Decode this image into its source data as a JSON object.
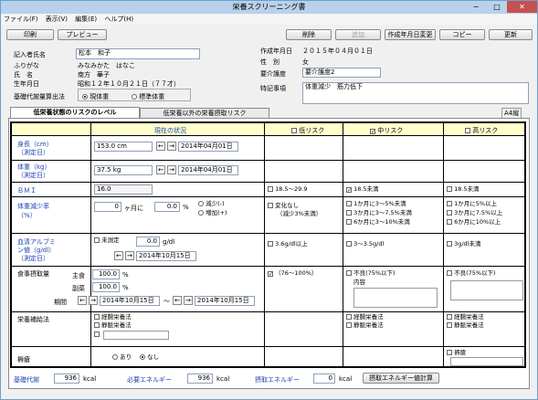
{
  "window": {
    "title": "栄養スクリーニング書",
    "min": "─",
    "max": "□",
    "close": "✕"
  },
  "menu": [
    "ファイル(F)",
    "表示(V)",
    "編集(E)",
    "ヘルプ(H)"
  ],
  "toolbar": {
    "print": "印刷",
    "preview": "プレビュー",
    "delete": "削除",
    "add": "追加",
    "create_date_change": "作成年月日変更",
    "copy": "コピー",
    "update": "更新"
  },
  "patient": {
    "writer_label": "記入者氏名",
    "writer": "松本　和子",
    "furigana_label": "ふりがな",
    "furigana": "みなみかた　はなこ",
    "name_label": "氏　名",
    "name": "南方　華子",
    "dob_label": "生年月日",
    "dob": "昭和１２年１０月２１日（７７才）",
    "bmr_method_label": "基礎代謝量算出法",
    "bmr_opt1": "現体重",
    "bmr_opt2": "標準体重",
    "created_label": "作成年月日",
    "created": "２０１５年０４月０１日",
    "sex_label": "性　別",
    "sex": "女",
    "care_label": "要介護度",
    "care": "要介護度2",
    "notes_label": "特記事項",
    "notes": "体重減少　筋力低下",
    "paper": "A4縦"
  },
  "tabs": [
    "低栄養状態のリスクのレベル",
    "低栄養以外の栄養摂取リスク"
  ],
  "header": {
    "current": "現在の状況",
    "low": "低リスク",
    "mid": "中リスク",
    "high": "高リスク"
  },
  "rows": {
    "height": {
      "label1": "身長（cm）",
      "label2": "（測定日）",
      "value": "153.0 cm",
      "date": "2014年04月01日"
    },
    "weight": {
      "label1": "体重（kg）",
      "label2": "（測定日）",
      "value": "37.5 kg",
      "date": "2014年04月01日"
    },
    "bmi": {
      "label": "ＢＭＩ",
      "value": "16.0",
      "low": "18.5～29.9",
      "mid": "18.5未満",
      "high": "18.5未満"
    },
    "loss": {
      "label1": "体重減少率",
      "label2": "（%）",
      "months": "0",
      "months_unit": "ヶ月に",
      "pct": "0.0",
      "pct_unit": "%",
      "dec": "減少(-)",
      "inc": "増加(+)",
      "low1": "変化なし",
      "low2": "（減少3%未満）",
      "mid1": "1か月に3～5%未満",
      "mid2": "3か月に3～7.5%未満",
      "mid3": "6か月に3～10%未満",
      "high1": "1か月に5%以上",
      "high2": "3か月に7.5%以上",
      "high3": "6か月に10%以上"
    },
    "albumin": {
      "label1": "血清アルブミ",
      "label2": "ン値（g/dl）",
      "label3": "（測定日）",
      "unmeasured": "未測定",
      "value": "0.0",
      "unit": "g/dl",
      "date": "2014年10月15日",
      "low": "3.6g/dl以上",
      "mid": "3～3.5g/dl",
      "high": "3g/dl未満"
    },
    "intake": {
      "label": "食事摂取量",
      "staple_label": "主食",
      "staple": "100.0",
      "side_label": "副菜",
      "side": "100.0",
      "pct": "%",
      "period_label": "期間",
      "from": "2014年10月15日",
      "tilde": "～",
      "to": "2014年10月15日",
      "low": "（76～100%）",
      "mid": "不良(75%以下)",
      "mid_content": "内容",
      "high": "不良(75%以下)"
    },
    "supp": {
      "label": "栄養補給法",
      "enteral": "経腸栄養法",
      "parenteral": "静脈栄養法"
    },
    "ulcer": {
      "label": "褥瘡",
      "yes": "あり",
      "no": "なし",
      "high": "褥瘡"
    }
  },
  "footer": {
    "bmr_label": "基礎代謝",
    "bmr": "936",
    "kcal": "kcal",
    "need_label": "必要エネルギー",
    "need": "936",
    "intake_label": "摂取エネルギー",
    "intake": "0",
    "calc_btn": "摂取エネルギー値計算"
  }
}
